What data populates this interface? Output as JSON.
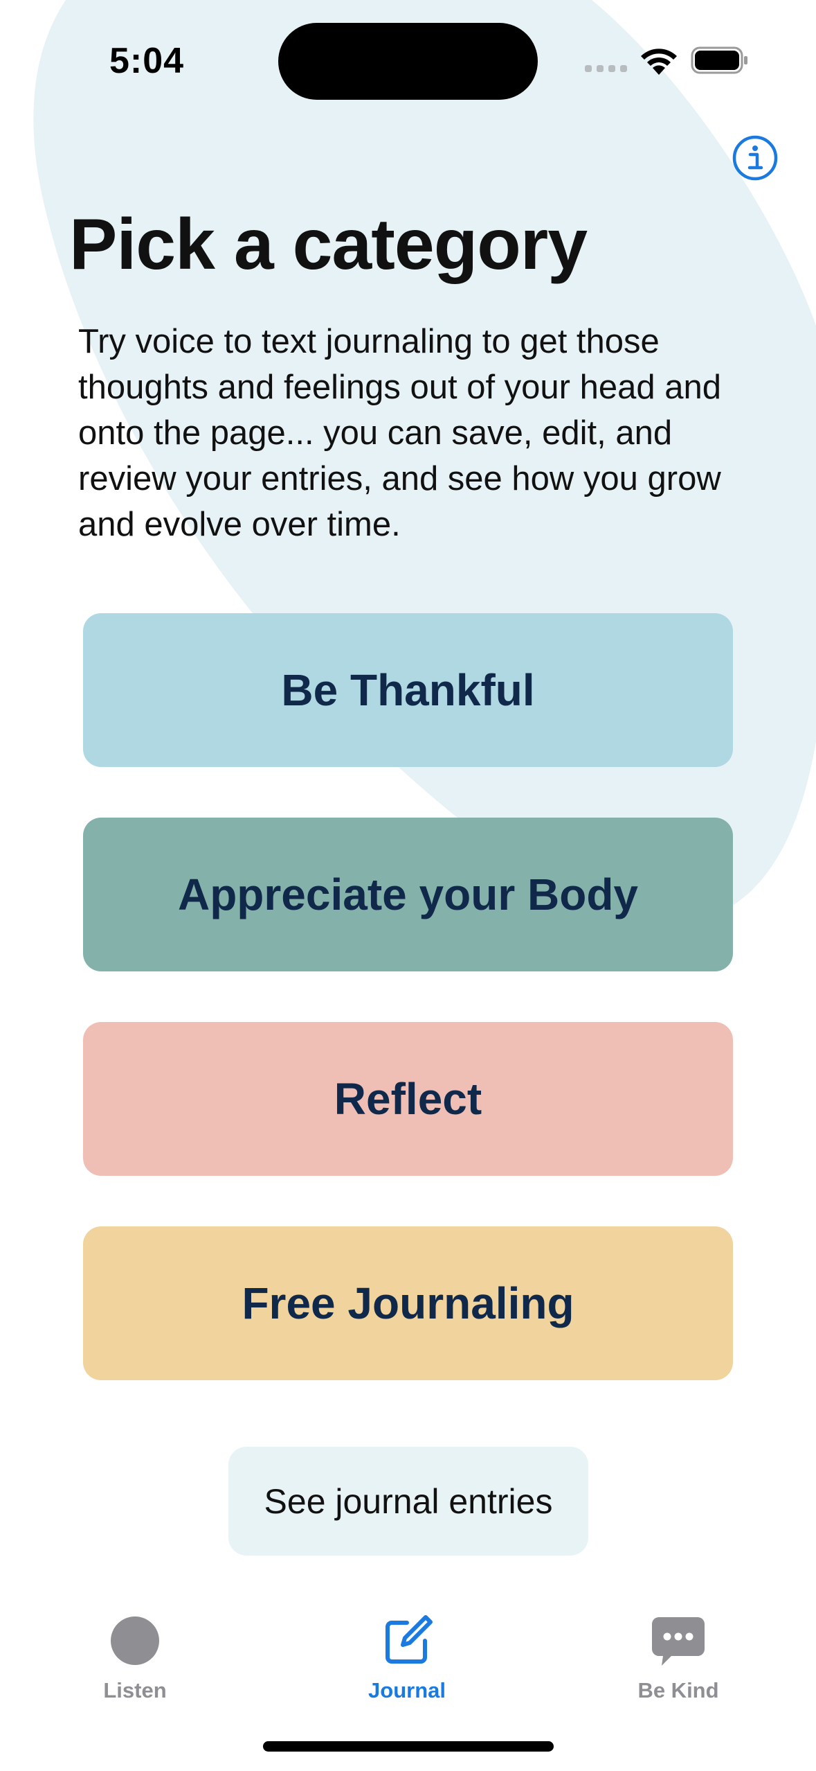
{
  "status_bar": {
    "time": "5:04"
  },
  "header": {
    "info_icon": "info-icon"
  },
  "main": {
    "title": "Pick a category",
    "description": "Try voice to text journaling to get those thoughts and feelings out of your head and onto the page... you can save, edit, and review your entries, and see how you grow and evolve over time.",
    "categories": [
      {
        "label": "Be Thankful",
        "color": "#afd8e3"
      },
      {
        "label": "Appreciate your Body",
        "color": "#84b2aa"
      },
      {
        "label": "Reflect",
        "color": "#efbfb5"
      },
      {
        "label": "Free Journaling",
        "color": "#f0d39d"
      }
    ],
    "entries_button_label": "See journal entries"
  },
  "tab_bar": {
    "items": [
      {
        "label": "Listen",
        "icon": "circle-icon",
        "active": false
      },
      {
        "label": "Journal",
        "icon": "compose-icon",
        "active": true
      },
      {
        "label": "Be Kind",
        "icon": "chat-bubble-icon",
        "active": false
      }
    ]
  },
  "colors": {
    "accent": "#1a7ae0",
    "inactive_tab": "#8e8e93",
    "blob": "#e6f2f5",
    "button_text": "#10294a"
  }
}
